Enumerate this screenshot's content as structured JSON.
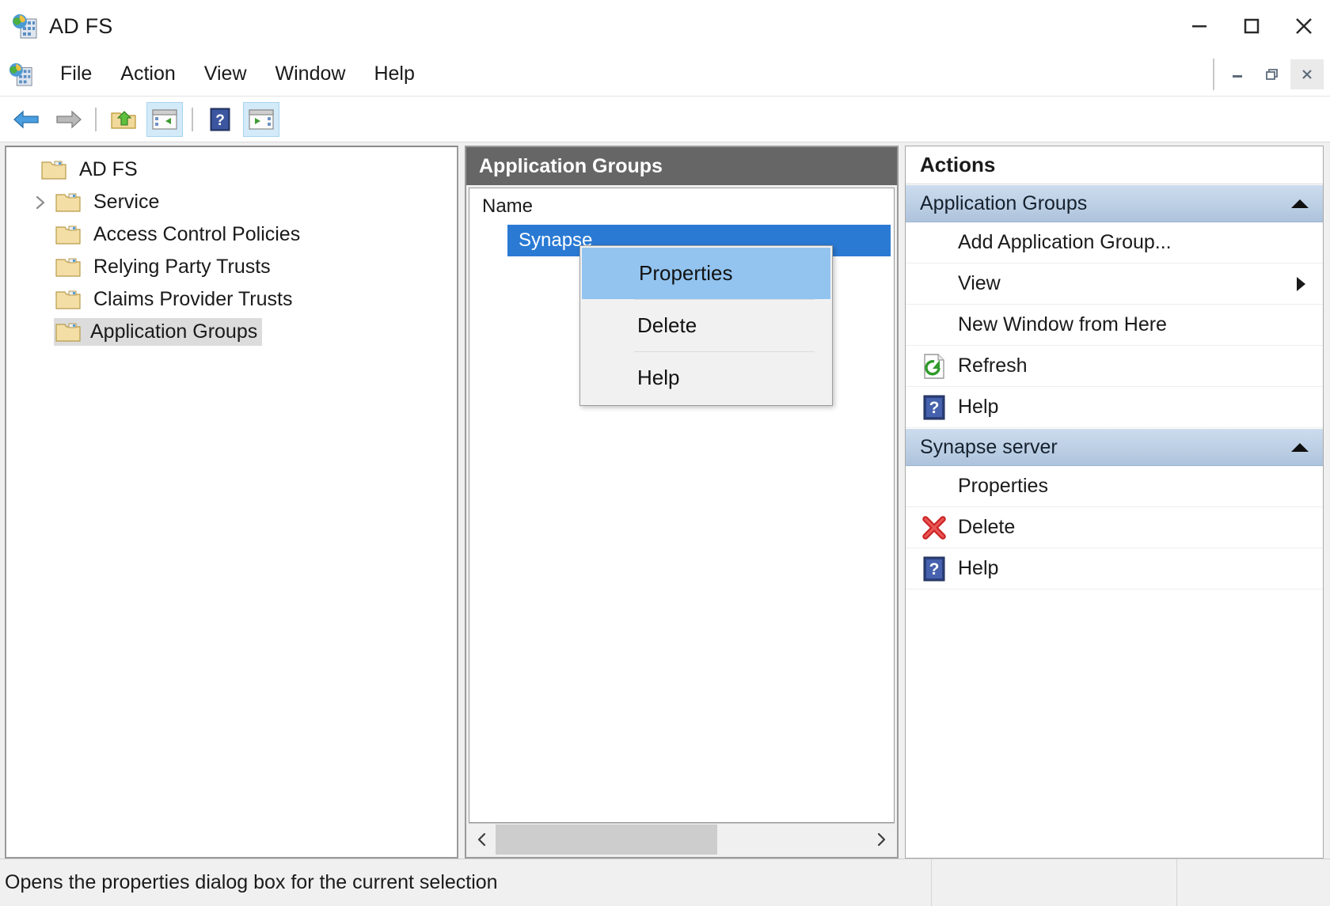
{
  "window": {
    "title": "AD FS",
    "app_icon": "adfs-icon",
    "controls": {
      "minimize": "minimize-icon",
      "maximize": "maximize-icon",
      "close": "close-icon"
    }
  },
  "menubar": {
    "icon": "adfs-icon",
    "items": [
      {
        "label": "File"
      },
      {
        "label": "Action"
      },
      {
        "label": "View"
      },
      {
        "label": "Window"
      },
      {
        "label": "Help"
      }
    ],
    "mdi_controls": {
      "minimize": "mdi-minimize-icon",
      "restore": "mdi-restore-icon",
      "close": "mdi-close-icon"
    }
  },
  "toolbar": {
    "buttons": [
      {
        "name": "back-button",
        "icon": "back-arrow-icon",
        "pressed": false
      },
      {
        "name": "forward-button",
        "icon": "forward-arrow-icon",
        "pressed": false
      },
      {
        "name": "up-one-level-button",
        "icon": "folder-up-icon",
        "pressed": false
      },
      {
        "name": "show-hide-tree-button",
        "icon": "show-tree-icon",
        "pressed": true
      },
      {
        "name": "help-button",
        "icon": "help-question-icon",
        "pressed": false
      },
      {
        "name": "show-hide-action-pane-button",
        "icon": "show-action-pane-icon",
        "pressed": true
      }
    ]
  },
  "tree": {
    "items": [
      {
        "label": "AD FS",
        "indent": 0,
        "twisty": "none",
        "selected": false,
        "icon": "folder-icon"
      },
      {
        "label": "Service",
        "indent": 1,
        "twisty": "collapsed",
        "selected": false,
        "icon": "folder-icon"
      },
      {
        "label": "Access Control Policies",
        "indent": 1,
        "twisty": "none",
        "selected": false,
        "icon": "folder-icon"
      },
      {
        "label": "Relying Party Trusts",
        "indent": 1,
        "twisty": "none",
        "selected": false,
        "icon": "folder-icon"
      },
      {
        "label": "Claims Provider Trusts",
        "indent": 1,
        "twisty": "none",
        "selected": false,
        "icon": "folder-icon"
      },
      {
        "label": "Application Groups",
        "indent": 1,
        "twisty": "none",
        "selected": true,
        "icon": "folder-icon"
      }
    ]
  },
  "list_pane": {
    "header": "Application Groups",
    "columns": [
      "Name"
    ],
    "rows": [
      {
        "name": "Synapse",
        "selected": true
      }
    ],
    "scrollbar": {
      "left_arrow": "chevron-left-icon",
      "right_arrow": "chevron-right-icon"
    }
  },
  "context_menu": {
    "items": [
      {
        "label": "Properties",
        "highlighted": true
      },
      {
        "label": "Delete",
        "highlighted": false
      },
      {
        "label": "Help",
        "highlighted": false
      }
    ]
  },
  "actions_pane": {
    "title": "Actions",
    "groups": [
      {
        "header": "Application Groups",
        "collapse_icon": "collapse-up-arrow-icon",
        "items": [
          {
            "label": "Add Application Group...",
            "icon": "none",
            "submenu": false
          },
          {
            "label": "View",
            "icon": "none",
            "submenu": true
          },
          {
            "label": "New Window from Here",
            "icon": "none",
            "submenu": false
          },
          {
            "label": "Refresh",
            "icon": "refresh-icon",
            "submenu": false
          },
          {
            "label": "Help",
            "icon": "help-question-icon",
            "submenu": false
          }
        ]
      },
      {
        "header": "Synapse server",
        "collapse_icon": "collapse-up-arrow-icon",
        "items": [
          {
            "label": "Properties",
            "icon": "none",
            "submenu": false
          },
          {
            "label": "Delete",
            "icon": "red-x-icon",
            "submenu": false
          },
          {
            "label": "Help",
            "icon": "help-question-icon",
            "submenu": false
          }
        ]
      }
    ]
  },
  "statusbar": {
    "message": "Opens the properties dialog box for the current selection"
  },
  "colors": {
    "selection_blue": "#2a7ad4",
    "menu_highlight": "#93c4f0",
    "group_header_blue": "#bccfe4",
    "list_header_gray": "#666666",
    "tree_selection_gray": "#dcdcdc",
    "red_x": "#cc2222",
    "refresh_green": "#3a9c34"
  }
}
